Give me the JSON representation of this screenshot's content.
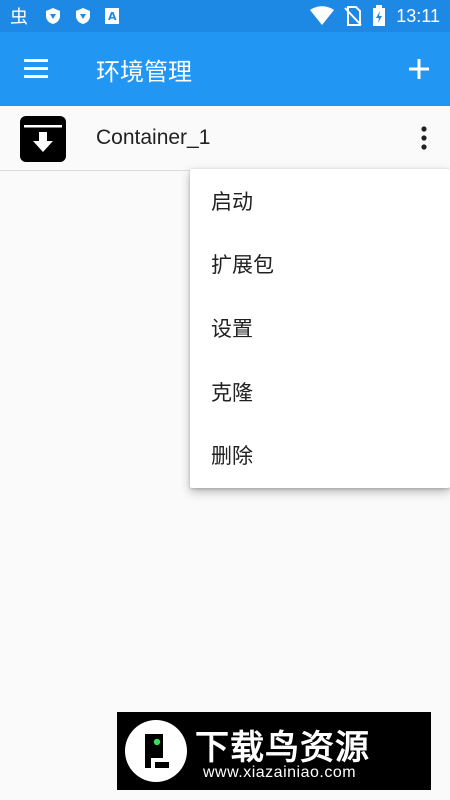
{
  "status_bar": {
    "time": "13:11",
    "left_icons": [
      "bug-icon",
      "shield-icon",
      "shield-icon",
      "font-a-icon"
    ],
    "right_icons": [
      "wifi-icon",
      "no-sim-icon",
      "battery-charging-icon"
    ]
  },
  "app_bar": {
    "title": "环境管理",
    "menu_icon": "hamburger-menu-icon",
    "add_icon": "plus-icon",
    "color": "#2196f3"
  },
  "containers": [
    {
      "label": "Container_1",
      "icon": "archive-download-icon"
    }
  ],
  "popup_menu": {
    "items": [
      {
        "label": "启动"
      },
      {
        "label": "扩展包"
      },
      {
        "label": "设置"
      },
      {
        "label": "克隆"
      },
      {
        "label": "删除"
      }
    ]
  },
  "watermark": {
    "title": "下载鸟资源",
    "url": "www.xiazainiao.com"
  }
}
